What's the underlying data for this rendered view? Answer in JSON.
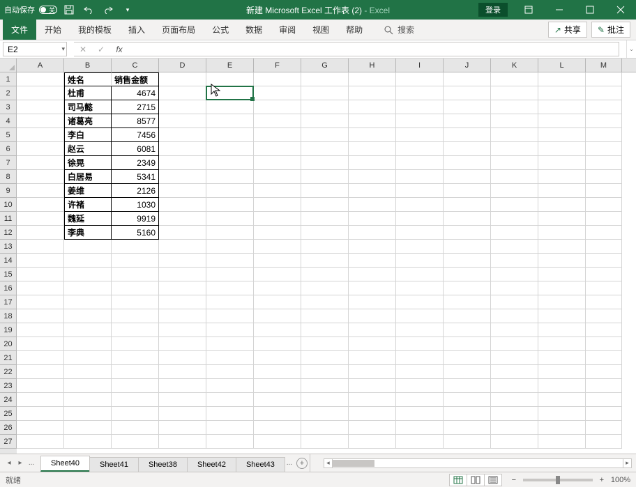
{
  "titlebar": {
    "autosave_label": "自动保存",
    "autosave_state": "关",
    "doc_title": "新建 Microsoft Excel 工作表 (2)",
    "app_suffix": " - Excel",
    "login": "登录"
  },
  "ribbon": {
    "tabs": [
      "文件",
      "开始",
      "我的模板",
      "插入",
      "页面布局",
      "公式",
      "数据",
      "审阅",
      "视图",
      "帮助"
    ],
    "search_placeholder": "搜索",
    "share": "共享",
    "comments": "批注"
  },
  "formula_bar": {
    "name_box": "E2",
    "fx_label": "fx",
    "formula": ""
  },
  "columns": [
    "A",
    "B",
    "C",
    "D",
    "E",
    "F",
    "G",
    "H",
    "I",
    "J",
    "K",
    "L",
    "M"
  ],
  "rows": [
    1,
    2,
    3,
    4,
    5,
    6,
    7,
    8,
    9,
    10,
    11,
    12,
    13,
    14,
    15,
    16,
    17,
    18,
    19,
    20,
    21,
    22,
    23,
    24,
    25,
    26,
    27
  ],
  "table": {
    "header": {
      "B": "姓名",
      "C": "销售金额"
    },
    "data": [
      {
        "B": "杜甫",
        "C": 4674
      },
      {
        "B": "司马懿",
        "C": 2715
      },
      {
        "B": "诸葛亮",
        "C": 8577
      },
      {
        "B": "李白",
        "C": 7456
      },
      {
        "B": "赵云",
        "C": 6081
      },
      {
        "B": "徐晃",
        "C": 2349
      },
      {
        "B": "白居易",
        "C": 5341
      },
      {
        "B": "姜维",
        "C": 2126
      },
      {
        "B": "许褚",
        "C": 1030
      },
      {
        "B": "魏延",
        "C": 9919
      },
      {
        "B": "李典",
        "C": 5160
      }
    ]
  },
  "active_cell": "E2",
  "sheets": {
    "tabs": [
      "Sheet40",
      "Sheet41",
      "Sheet38",
      "Sheet42",
      "Sheet43"
    ],
    "active": "Sheet40",
    "more": "..."
  },
  "status": {
    "mode": "就绪",
    "zoom": "100%"
  },
  "colors": {
    "brand": "#217346"
  }
}
